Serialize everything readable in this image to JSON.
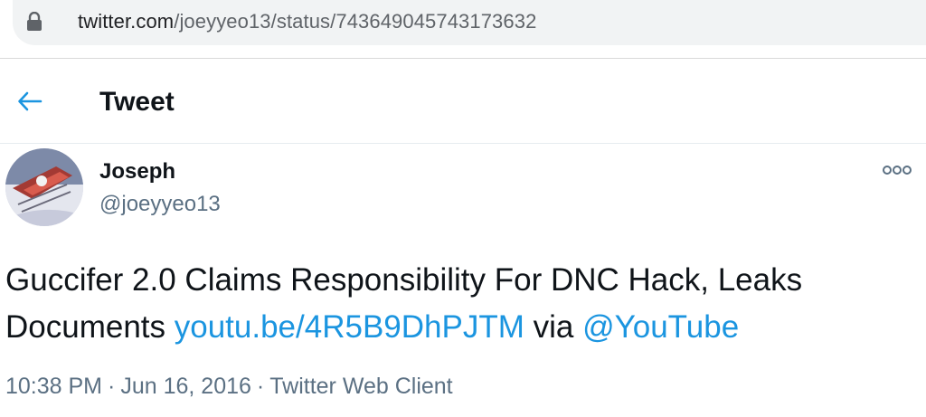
{
  "browser": {
    "url_domain": "twitter.com",
    "url_path": "/joeyyeo13/status/743649045743173632",
    "lock_icon": "lock-icon"
  },
  "header": {
    "back_icon": "back-arrow-icon",
    "title": "Tweet"
  },
  "tweet": {
    "author_name": "Joseph",
    "author_handle": "@joeyyeo13",
    "more_icon": "more-options-icon",
    "text_before": "Guccifer 2.0 Claims Responsibility For DNC Hack, Leaks Documents ",
    "link": "youtu.be/4R5B9DhPJTM",
    "via_text": " via ",
    "mention": "@YouTube",
    "time": "10:38 PM",
    "separator": "·",
    "date": "Jun 16, 2016",
    "client": "Twitter Web Client"
  },
  "colors": {
    "accent": "#1b95e0",
    "text": "#0f1419",
    "secondary": "#5b7083"
  }
}
